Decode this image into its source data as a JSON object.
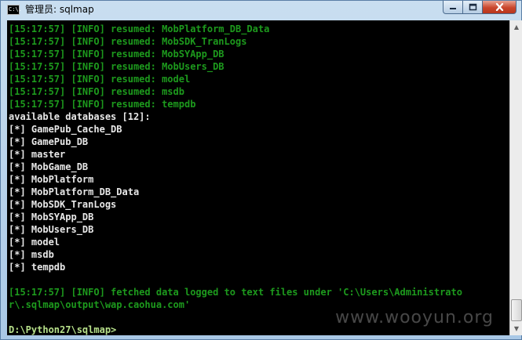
{
  "window": {
    "title": "管理员: sqlmap",
    "icon_label": "C:\\."
  },
  "console": {
    "lines": [
      {
        "text": "[15:17:57] [INFO] resumed: MobPlatform_DB_Data",
        "color": "green"
      },
      {
        "text": "[15:17:57] [INFO] resumed: MobSDK_TranLogs",
        "color": "green"
      },
      {
        "text": "[15:17:57] [INFO] resumed: MobSYApp_DB",
        "color": "green"
      },
      {
        "text": "[15:17:57] [INFO] resumed: MobUsers_DB",
        "color": "green"
      },
      {
        "text": "[15:17:57] [INFO] resumed: model",
        "color": "green"
      },
      {
        "text": "[15:17:57] [INFO] resumed: msdb",
        "color": "green"
      },
      {
        "text": "[15:17:57] [INFO] resumed: tempdb",
        "color": "green"
      },
      {
        "text": "available databases [12]:",
        "color": "white"
      },
      {
        "text": "[*] GamePub_Cache_DB",
        "color": "white"
      },
      {
        "text": "[*] GamePub_DB",
        "color": "white"
      },
      {
        "text": "[*] master",
        "color": "white"
      },
      {
        "text": "[*] MobGame_DB",
        "color": "white"
      },
      {
        "text": "[*] MobPlatform",
        "color": "white"
      },
      {
        "text": "[*] MobPlatform_DB_Data",
        "color": "white"
      },
      {
        "text": "[*] MobSDK_TranLogs",
        "color": "white"
      },
      {
        "text": "[*] MobSYApp_DB",
        "color": "white"
      },
      {
        "text": "[*] MobUsers_DB",
        "color": "white"
      },
      {
        "text": "[*] model",
        "color": "white"
      },
      {
        "text": "[*] msdb",
        "color": "white"
      },
      {
        "text": "[*] tempdb",
        "color": "white"
      },
      {
        "text": "",
        "color": "white"
      },
      {
        "text": "[15:17:57] [INFO] fetched data logged to text files under 'C:\\Users\\Administrato",
        "color": "green"
      },
      {
        "text": "r\\.sqlmap\\output\\wap.caohua.com'",
        "color": "green"
      },
      {
        "text": "",
        "color": "white"
      },
      {
        "text": "D:\\Python27\\sqlmap>",
        "color": "prompt"
      }
    ]
  },
  "watermark": "www.wooyun.org",
  "colors": {
    "green": "#1d9a1d",
    "white": "#e8e8e8",
    "prompt": "#b7e08a",
    "background": "#000000"
  }
}
